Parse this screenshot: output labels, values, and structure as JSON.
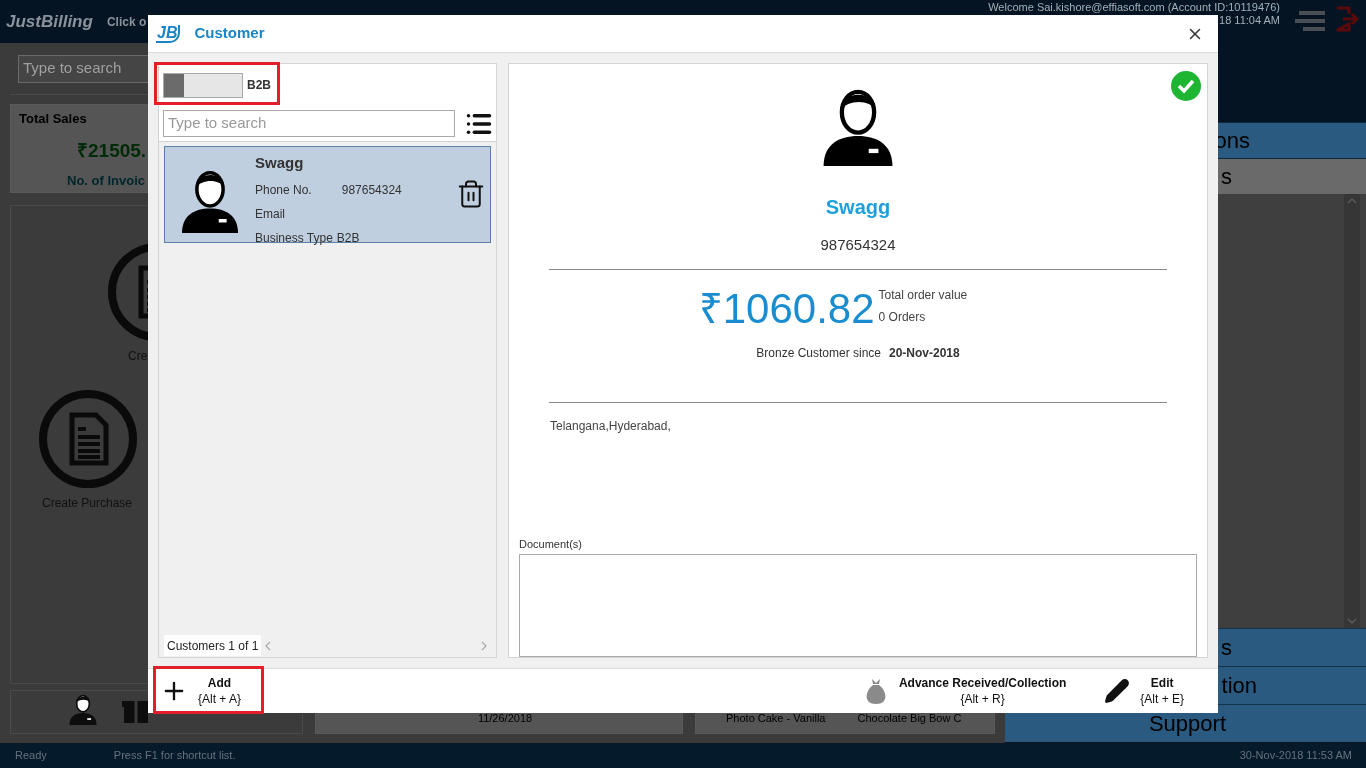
{
  "app": {
    "logo": "JustBilling",
    "header_hint": "Click o",
    "welcome": "Welcome Sai.kishore@effiasoft.com (Account ID:10119476)",
    "header_time": "18 11:04 AM"
  },
  "background": {
    "search_placeholder": "Type to search",
    "total_sales": {
      "title": "Total Sales",
      "amount": "₹21505.",
      "invoices": "No. of Invoic"
    },
    "tiles": [
      "Cre",
      "Create Purchase"
    ],
    "cards": [
      "11/26/2018",
      "Photo Cake - Vanilla",
      "Chocolate Big Bow C"
    ]
  },
  "side_menu": [
    {
      "label": "ons",
      "selected": false
    },
    {
      "label": "s",
      "selected": true
    }
  ],
  "side_menu_bottom": [
    "s",
    "tion",
    "Support"
  ],
  "status_bar": {
    "state": "Ready",
    "hint": "Press F1 for shortcut list.",
    "time": "30-Nov-2018 11:53 AM"
  },
  "dialog": {
    "logo": "JB",
    "title": "Customer",
    "toggle": {
      "label": "B2B",
      "on": false
    },
    "search": {
      "placeholder": "Type to search"
    },
    "customers": [
      {
        "name": "Swagg",
        "phone_label": "Phone No.",
        "phone": "987654324",
        "email_label": "Email",
        "business_type_label": "Business Type",
        "business_type": "B2B",
        "selected": true
      }
    ],
    "count": "Customers 1 of 1",
    "detail": {
      "verified": true,
      "name": "Swagg",
      "phone": "987654324",
      "amount": "₹1060.82",
      "amount_label": "Total order value",
      "orders": "0 Orders",
      "tier": "Bronze Customer since",
      "since": "20-Nov-2018",
      "address": "Telangana,Hyderabad,",
      "documents_label": "Document(s)"
    },
    "actions": [
      {
        "kind": "add",
        "label": "Add",
        "shortcut": "{Alt + A}"
      },
      {
        "kind": "advance",
        "label": "Advance Received/Collection",
        "shortcut": "{Alt + R}"
      },
      {
        "kind": "edit",
        "label": "Edit",
        "shortcut": "{Alt + E}"
      }
    ]
  }
}
